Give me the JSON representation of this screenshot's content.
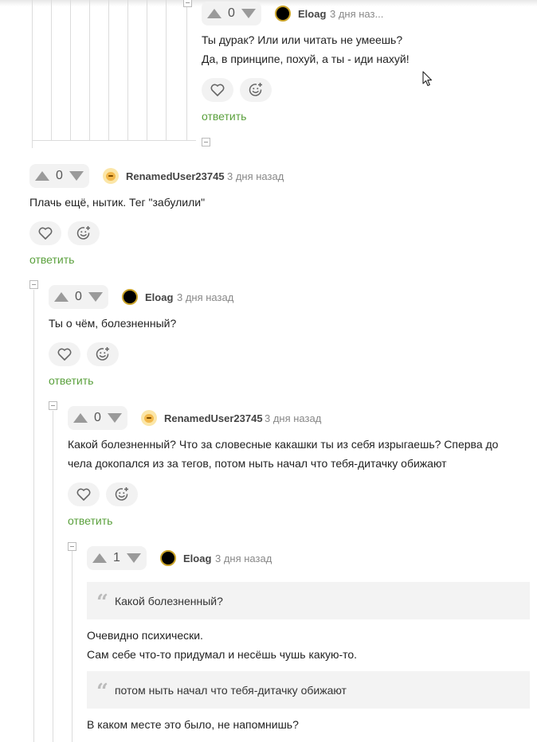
{
  "comments": [
    {
      "rating": "0",
      "author": "Eloag",
      "time": "3 дня наз...",
      "lines": [
        "Ты дурак? Или или читать не умеешь?",
        "Да, в принципе, похуй, а ты - иди нахуй!"
      ],
      "reply_label": "ответить"
    },
    {
      "rating": "0",
      "author": "RenamedUser23745",
      "time": "3 дня назад",
      "lines": [
        "Плачь ещё, нытик. Тег \"забулили\""
      ],
      "reply_label": "ответить"
    },
    {
      "rating": "0",
      "author": "Eloag",
      "time": "3 дня назад",
      "lines": [
        "Ты о чём, болезненный?"
      ],
      "reply_label": "ответить"
    },
    {
      "rating": "0",
      "author": "RenamedUser23745",
      "time": "3 дня назад",
      "lines": [
        "Какой болезненный? Что за словесные какашки ты из себя изрыгаешь? Сперва до",
        "чела докопался из за тегов, потом ныть начал что тебя-дитачку обижают"
      ],
      "reply_label": "ответить"
    },
    {
      "rating": "1",
      "author": "Eloag",
      "time": "3 дня назад",
      "quote1": "Какой болезненный?",
      "lines": [
        "Очевидно психически.",
        "Сам себе что-то придумал и несёшь чушь какую-то."
      ],
      "quote2": "потом ныть начал что тебя-дитачку обижают",
      "lines2": [
        "В каком месте это было, не напомнишь?"
      ]
    }
  ],
  "icons": {
    "upvote": "upvote-triangle-icon",
    "downvote": "downvote-triangle-icon",
    "like": "heart-icon",
    "reaction": "add-reaction-smiley-icon",
    "collapse": "collapse-minus-icon",
    "quote": "quote-mark-icon"
  },
  "colors": {
    "reply_link": "#5aa03c",
    "avatar_ring": "#c9a227",
    "control_bg": "#f2f2f2",
    "thread_line": "#dcdcdc"
  }
}
